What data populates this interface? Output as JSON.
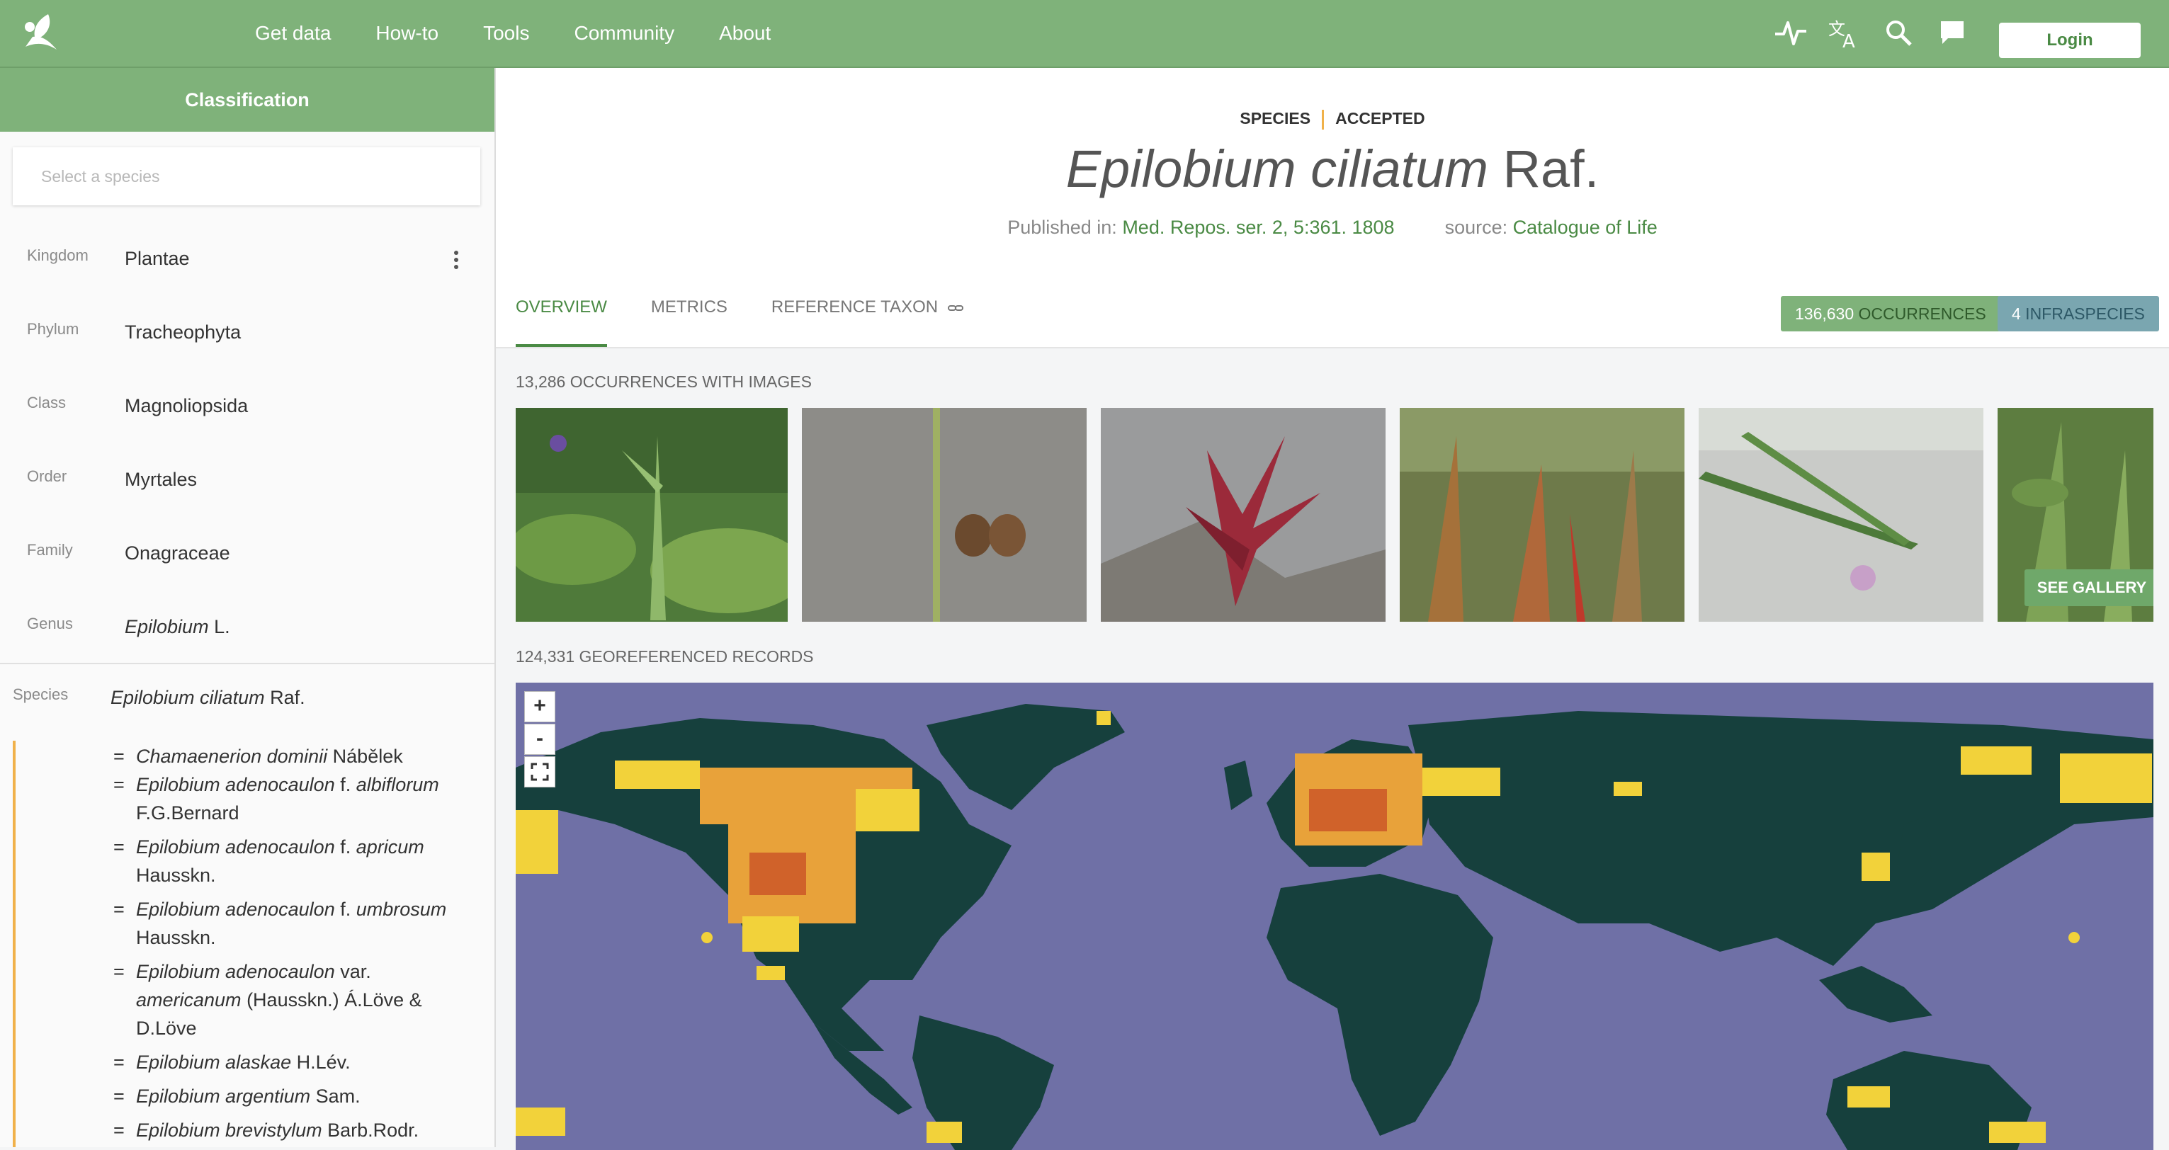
{
  "nav": {
    "items": [
      "Get data",
      "How-to",
      "Tools",
      "Community",
      "About"
    ],
    "login_label": "Login",
    "icons": [
      "activity-icon",
      "translate-icon",
      "search-icon",
      "feedback-icon"
    ]
  },
  "sidebar": {
    "title": "Classification",
    "search_placeholder": "Select a species",
    "ranks": [
      {
        "label": "Kingdom",
        "value": "Plantae"
      },
      {
        "label": "Phylum",
        "value": "Tracheophyta"
      },
      {
        "label": "Class",
        "value": "Magnoliopsida"
      },
      {
        "label": "Order",
        "value": "Myrtales"
      },
      {
        "label": "Family",
        "value": "Onagraceae"
      },
      {
        "label": "Genus",
        "value_italic": "Epilobium",
        "value_rest": " L."
      }
    ],
    "species": {
      "label": "Species",
      "name": "Epilobium ciliatum",
      "author": " Raf."
    },
    "synonyms": [
      {
        "name": "Chamaenerion dominii",
        "rest": " Nábělek"
      },
      {
        "name": "Epilobium adenocaulon",
        "rank": " f. ",
        "epithet": "albiflorum",
        "author": " F.G.Bernard"
      },
      {
        "name": "Epilobium adenocaulon",
        "rank": " f. ",
        "epithet": "apricum",
        "author": " Hausskn."
      },
      {
        "name": "Epilobium adenocaulon",
        "rank": " f. ",
        "epithet": "umbrosum",
        "author": " Hausskn."
      },
      {
        "name": "Epilobium adenocaulon",
        "rank": " var. ",
        "epithet": "americanum",
        "author": " (Hausskn.) Á.Löve & D.Löve"
      },
      {
        "name": "Epilobium alaskae",
        "rest": " H.Lév."
      },
      {
        "name": "Epilobium argentium",
        "rest": " Sam."
      },
      {
        "name": "Epilobium brevistylum",
        "rest": " Barb.Rodr."
      }
    ]
  },
  "header": {
    "rank": "SPECIES",
    "status": "ACCEPTED",
    "title_italic": "Epilobium ciliatum",
    "title_author": " Raf.",
    "published_label": "Published in: ",
    "published_value": "Med. Repos. ser. 2, 5:361. 1808",
    "source_label": "source: ",
    "source_value": "Catalogue of Life"
  },
  "tabs": [
    "OVERVIEW",
    "METRICS",
    "REFERENCE TAXON"
  ],
  "badges": {
    "occurrences_count": "136,630",
    "occurrences_label": " OCCURRENCES",
    "infraspecies_count": "4",
    "infraspecies_label": " INFRASPECIES"
  },
  "images": {
    "heading": "13,286 OCCURRENCES WITH IMAGES",
    "see_gallery": "SEE GALLERY"
  },
  "map": {
    "heading": "124,331 GEOREFERENCED RECORDS",
    "zoom_in": "+",
    "zoom_out": "-"
  }
}
